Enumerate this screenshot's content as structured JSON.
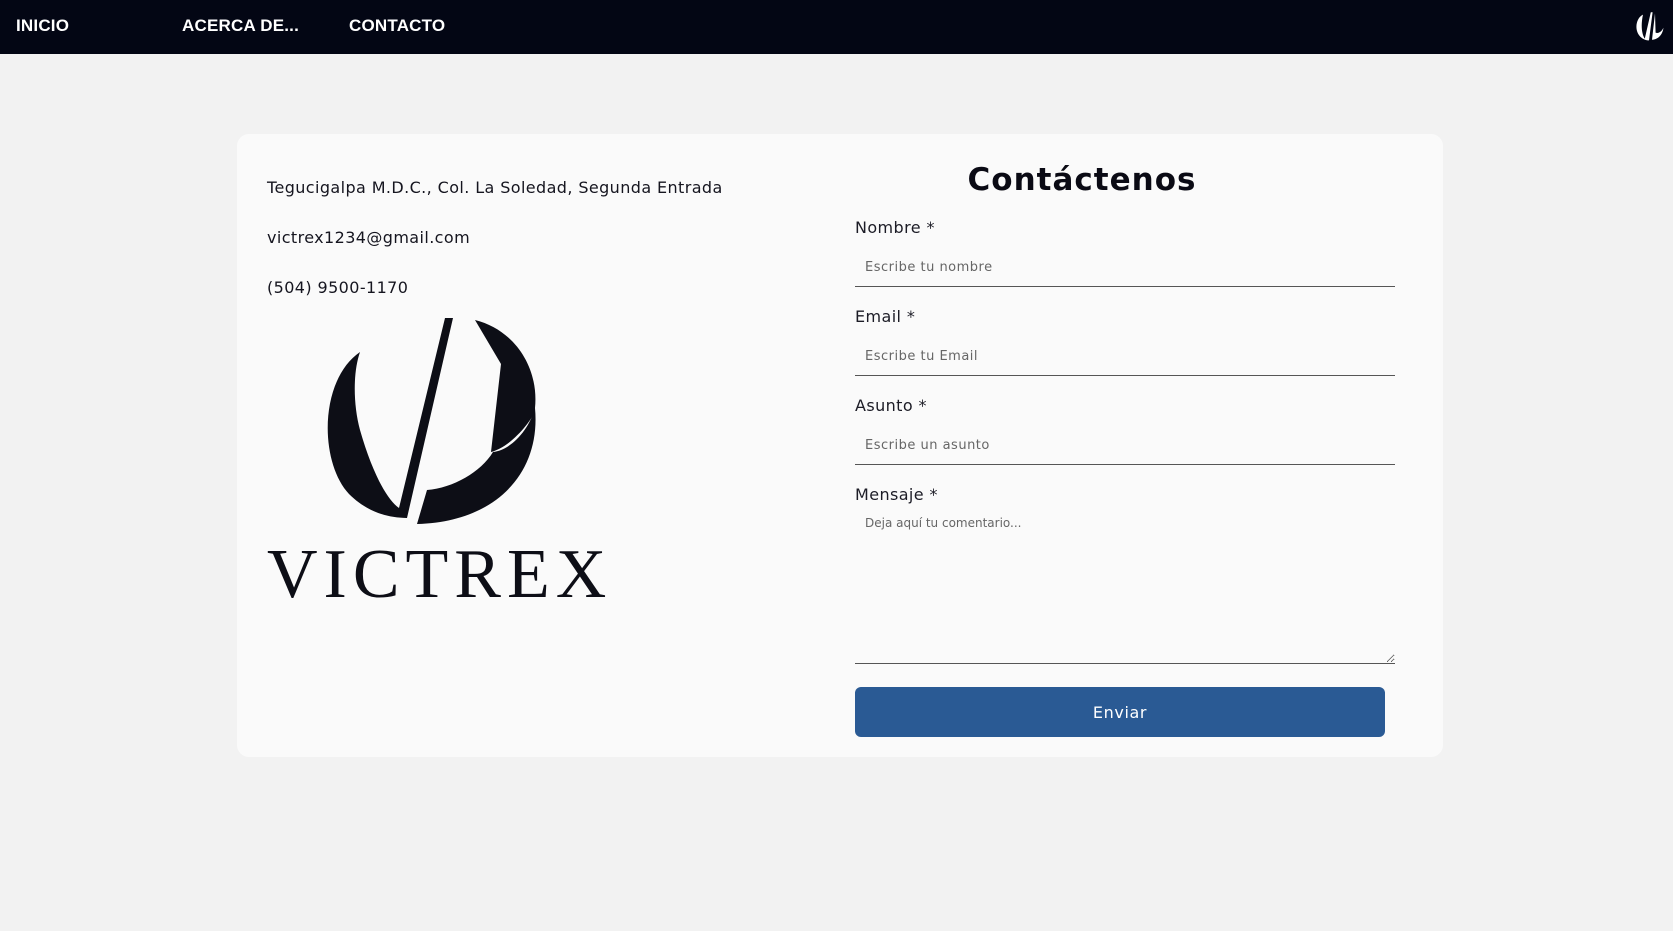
{
  "nav": {
    "items": [
      {
        "label": "INICIO"
      },
      {
        "label": "ACERCA DE..."
      },
      {
        "label": "CONTACTO"
      }
    ],
    "logo_icon": "victrex-vl-icon"
  },
  "contact_info": {
    "address": "Tegucigalpa M.D.C., Col. La Soledad, Segunda Entrada",
    "email": "victrex1234@gmail.com",
    "phone": "(504) 9500-1170",
    "logo_wordmark": "VICTREX"
  },
  "form": {
    "title": "Contáctenos",
    "fields": [
      {
        "label": "Nombre *",
        "placeholder": "Escribe tu nombre",
        "value": ""
      },
      {
        "label": "Email *",
        "placeholder": "Escribe tu Email",
        "value": ""
      },
      {
        "label": "Asunto *",
        "placeholder": "Escribe un asunto",
        "value": ""
      }
    ],
    "message": {
      "label": "Mensaje *",
      "placeholder": "Deja aquí tu comentario...",
      "value": ""
    },
    "submit_label": "Enviar"
  },
  "colors": {
    "navbar_bg": "#030614",
    "page_bg": "#f2f2f2",
    "card_bg": "#fafafa",
    "button_bg": "#2a5a94",
    "logo_dark": "#0d0e16"
  }
}
